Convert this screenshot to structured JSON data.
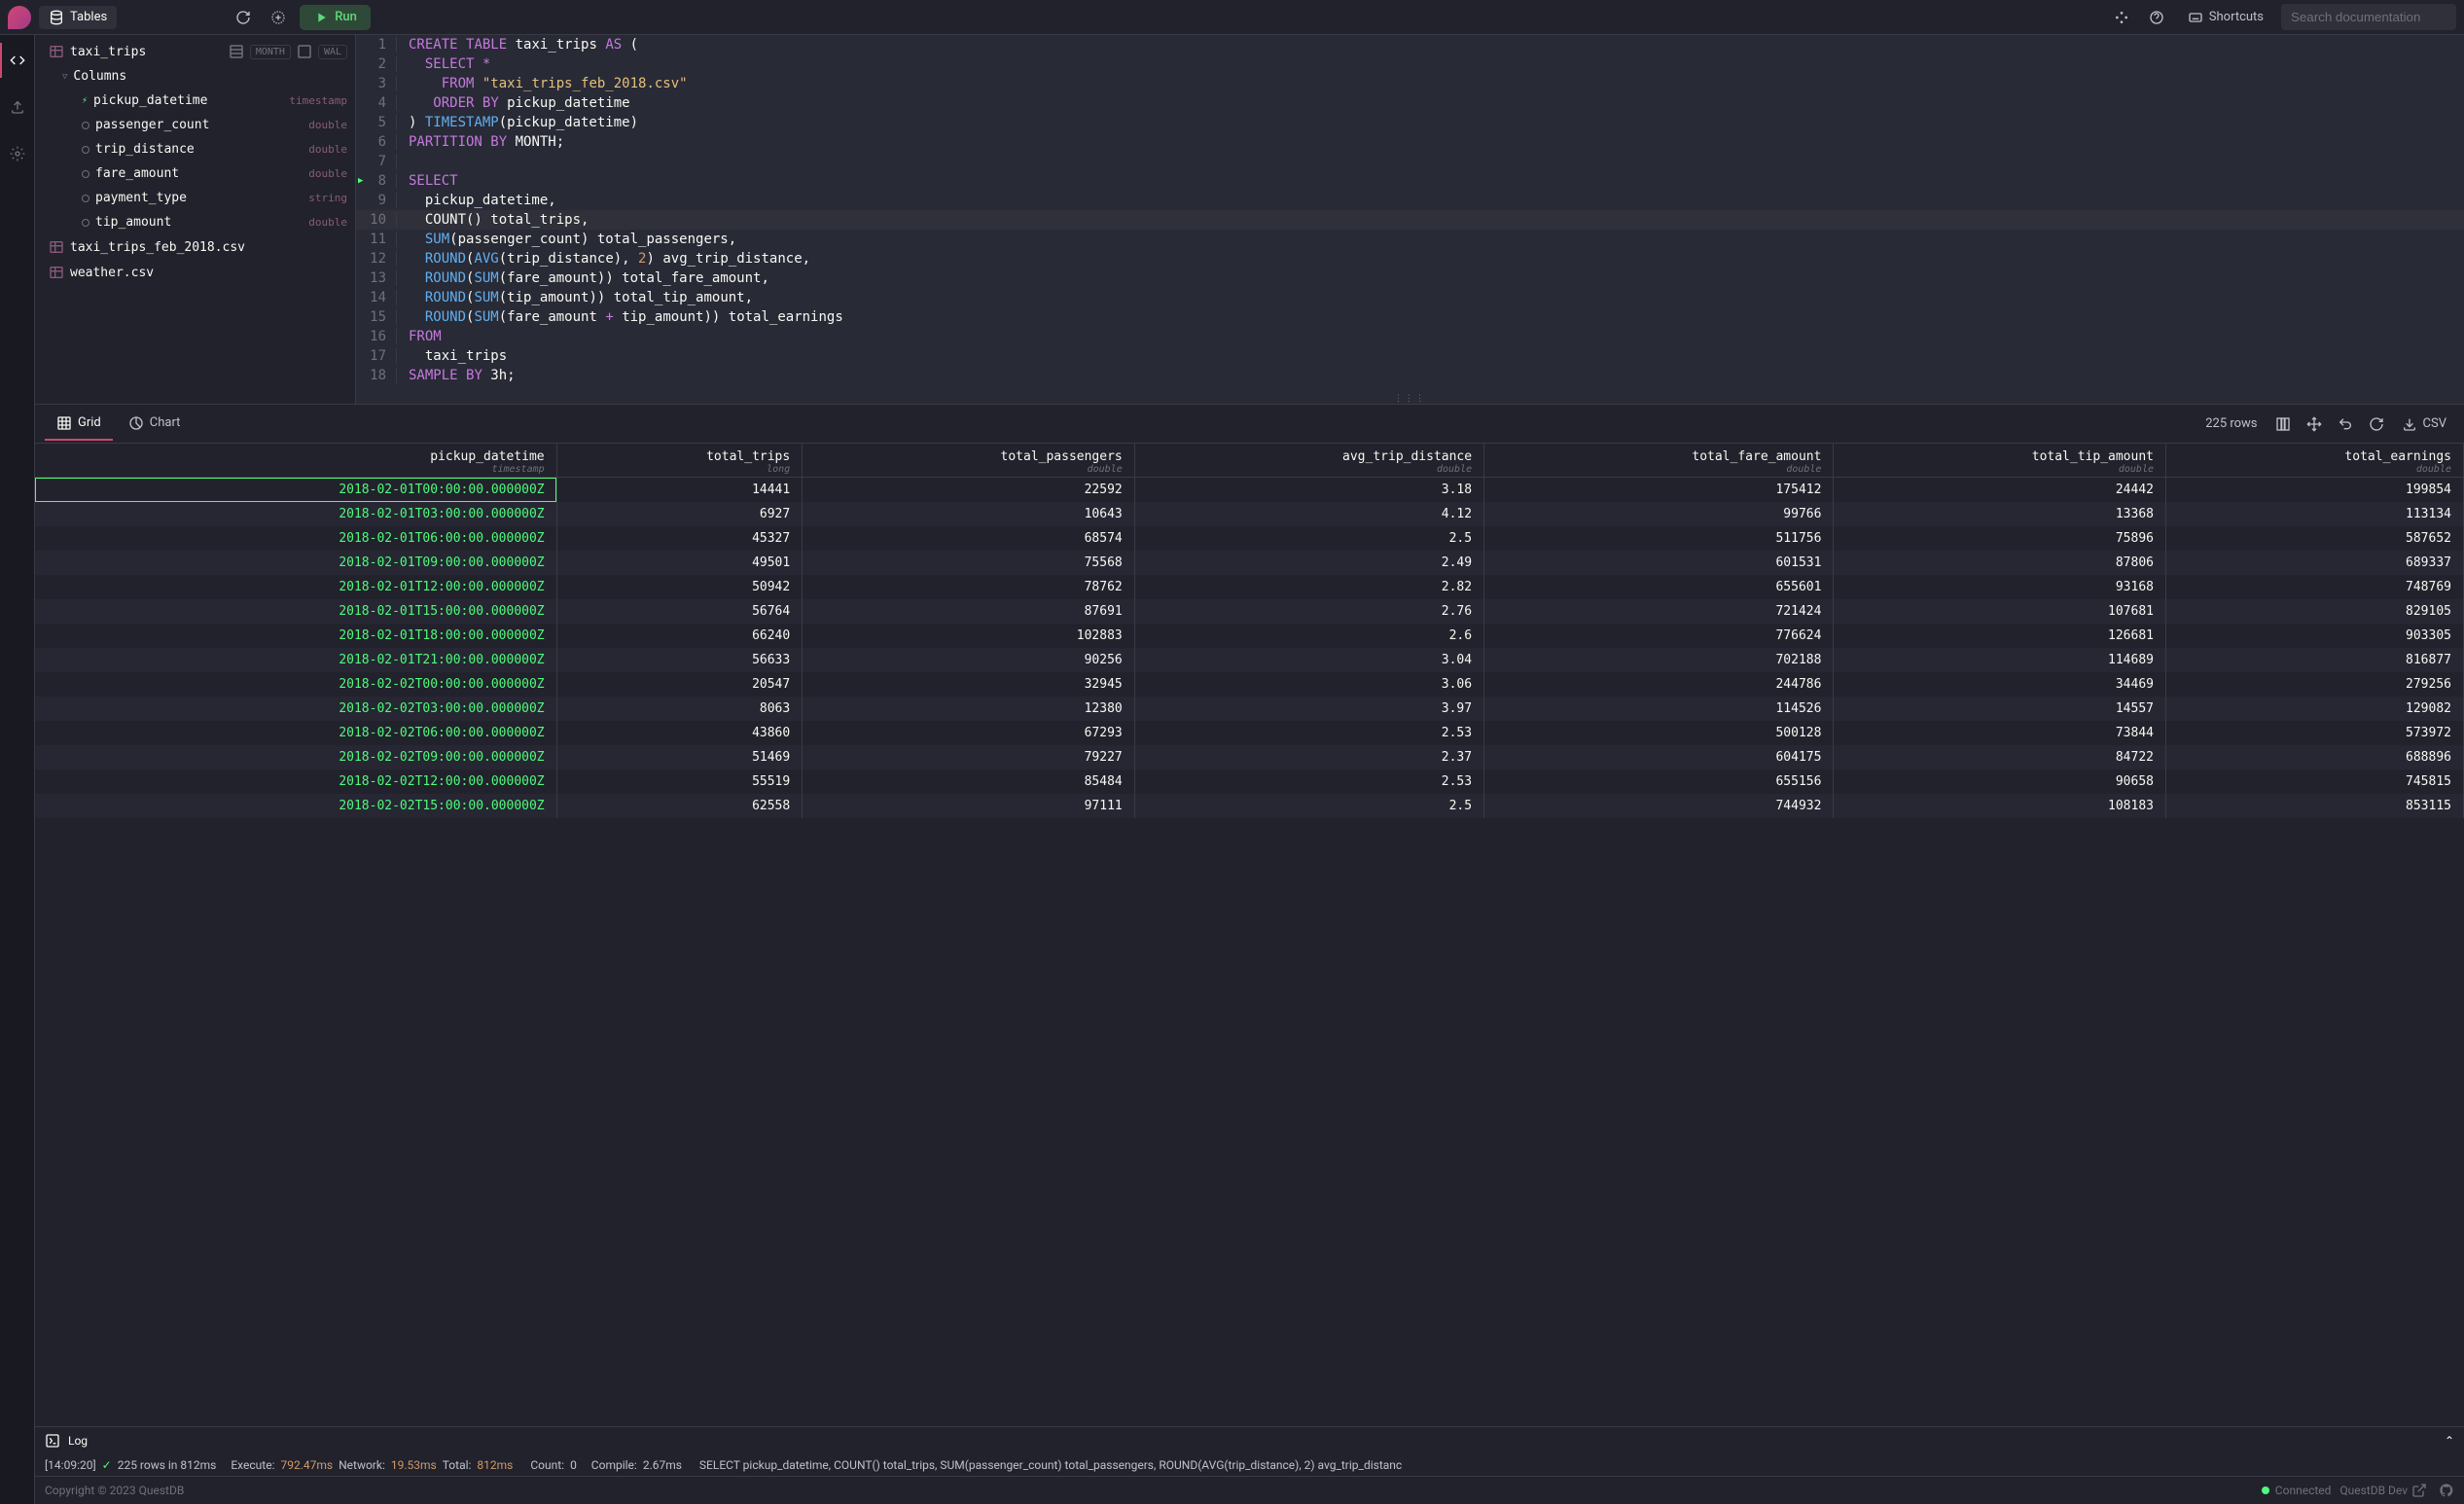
{
  "header": {
    "tables_label": "Tables",
    "run_label": "Run",
    "shortcuts_label": "Shortcuts",
    "search_placeholder": "Search documentation"
  },
  "sidebar": {
    "tables": [
      {
        "name": "taxi_trips",
        "partition": "MONTH",
        "wal": "WAL",
        "columns_label": "Columns",
        "columns": [
          {
            "name": "pickup_datetime",
            "type": "timestamp",
            "designated": true
          },
          {
            "name": "passenger_count",
            "type": "double",
            "designated": false
          },
          {
            "name": "trip_distance",
            "type": "double",
            "designated": false
          },
          {
            "name": "fare_amount",
            "type": "double",
            "designated": false
          },
          {
            "name": "payment_type",
            "type": "string",
            "designated": false
          },
          {
            "name": "tip_amount",
            "type": "double",
            "designated": false
          }
        ]
      },
      {
        "name": "taxi_trips_feb_2018.csv"
      },
      {
        "name": "weather.csv"
      }
    ]
  },
  "editor": {
    "lines": [
      {
        "n": 1,
        "html": "<span class='kw'>CREATE</span> <span class='kw'>TABLE</span> taxi_trips <span class='kw'>AS</span> ("
      },
      {
        "n": 2,
        "html": "  <span class='kw'>SELECT</span> <span class='star'>*</span>"
      },
      {
        "n": 3,
        "html": "    <span class='kw'>FROM</span> <span class='str'>\"taxi_trips_feb_2018.csv\"</span>"
      },
      {
        "n": 4,
        "html": "   <span class='kw'>ORDER</span> <span class='kw'>BY</span> pickup_datetime"
      },
      {
        "n": 5,
        "html": ") <span class='fn'>TIMESTAMP</span>(pickup_datetime)"
      },
      {
        "n": 6,
        "html": "<span class='kw'>PARTITION</span> <span class='kw'>BY</span> MONTH;"
      },
      {
        "n": 7,
        "html": ""
      },
      {
        "n": 8,
        "html": "<span class='kw'>SELECT</span>",
        "run": true
      },
      {
        "n": 9,
        "html": "  pickup_datetime,"
      },
      {
        "n": 10,
        "html": "  COUNT() total_trips,",
        "cursor": true
      },
      {
        "n": 11,
        "html": "  <span class='fn'>SUM</span>(passenger_count) total_passengers,"
      },
      {
        "n": 12,
        "html": "  <span class='fn'>ROUND</span>(<span class='fn'>AVG</span>(trip_distance), <span class='num'>2</span>) avg_trip_distance,"
      },
      {
        "n": 13,
        "html": "  <span class='fn'>ROUND</span>(<span class='fn'>SUM</span>(fare_amount)) total_fare_amount,"
      },
      {
        "n": 14,
        "html": "  <span class='fn'>ROUND</span>(<span class='fn'>SUM</span>(tip_amount)) total_tip_amount,"
      },
      {
        "n": 15,
        "html": "  <span class='fn'>ROUND</span>(<span class='fn'>SUM</span>(fare_amount <span class='kw'>+</span> tip_amount)) total_earnings"
      },
      {
        "n": 16,
        "html": "<span class='kw'>FROM</span>"
      },
      {
        "n": 17,
        "html": "  taxi_trips"
      },
      {
        "n": 18,
        "html": "<span class='kw'>SAMPLE</span> <span class='kw'>BY</span> 3h;"
      }
    ]
  },
  "results": {
    "grid_tab": "Grid",
    "chart_tab": "Chart",
    "rows_label": "225 rows",
    "csv_label": "CSV",
    "columns": [
      {
        "name": "pickup_datetime",
        "type": "timestamp"
      },
      {
        "name": "total_trips",
        "type": "long"
      },
      {
        "name": "total_passengers",
        "type": "double"
      },
      {
        "name": "avg_trip_distance",
        "type": "double"
      },
      {
        "name": "total_fare_amount",
        "type": "double"
      },
      {
        "name": "total_tip_amount",
        "type": "double"
      },
      {
        "name": "total_earnings",
        "type": "double"
      }
    ],
    "rows": [
      [
        "2018-02-01T00:00:00.000000Z",
        "14441",
        "22592",
        "3.18",
        "175412",
        "24442",
        "199854"
      ],
      [
        "2018-02-01T03:00:00.000000Z",
        "6927",
        "10643",
        "4.12",
        "99766",
        "13368",
        "113134"
      ],
      [
        "2018-02-01T06:00:00.000000Z",
        "45327",
        "68574",
        "2.5",
        "511756",
        "75896",
        "587652"
      ],
      [
        "2018-02-01T09:00:00.000000Z",
        "49501",
        "75568",
        "2.49",
        "601531",
        "87806",
        "689337"
      ],
      [
        "2018-02-01T12:00:00.000000Z",
        "50942",
        "78762",
        "2.82",
        "655601",
        "93168",
        "748769"
      ],
      [
        "2018-02-01T15:00:00.000000Z",
        "56764",
        "87691",
        "2.76",
        "721424",
        "107681",
        "829105"
      ],
      [
        "2018-02-01T18:00:00.000000Z",
        "66240",
        "102883",
        "2.6",
        "776624",
        "126681",
        "903305"
      ],
      [
        "2018-02-01T21:00:00.000000Z",
        "56633",
        "90256",
        "3.04",
        "702188",
        "114689",
        "816877"
      ],
      [
        "2018-02-02T00:00:00.000000Z",
        "20547",
        "32945",
        "3.06",
        "244786",
        "34469",
        "279256"
      ],
      [
        "2018-02-02T03:00:00.000000Z",
        "8063",
        "12380",
        "3.97",
        "114526",
        "14557",
        "129082"
      ],
      [
        "2018-02-02T06:00:00.000000Z",
        "43860",
        "67293",
        "2.53",
        "500128",
        "73844",
        "573972"
      ],
      [
        "2018-02-02T09:00:00.000000Z",
        "51469",
        "79227",
        "2.37",
        "604175",
        "84722",
        "688896"
      ],
      [
        "2018-02-02T12:00:00.000000Z",
        "55519",
        "85484",
        "2.53",
        "655156",
        "90658",
        "745815"
      ],
      [
        "2018-02-02T15:00:00.000000Z",
        "62558",
        "97111",
        "2.5",
        "744932",
        "108183",
        "853115"
      ]
    ]
  },
  "log": {
    "label": "Log",
    "timestamp": "[14:09:20]",
    "rows_msg": "225 rows in 812ms",
    "execute_label": "Execute:",
    "execute_time": "792.47ms",
    "network_label": "Network:",
    "network_time": "19.53ms",
    "total_label": "Total:",
    "total_time": "812ms",
    "count_label": "Count:",
    "count_val": "0",
    "compile_label": "Compile:",
    "compile_time": "2.67ms",
    "query": "SELECT pickup_datetime, COUNT() total_trips, SUM(passenger_count) total_passengers, ROUND(AVG(trip_distance), 2) avg_trip_distanc"
  },
  "footer": {
    "copyright": "Copyright © 2023 QuestDB",
    "connected": "Connected",
    "dev": "QuestDB Dev"
  }
}
